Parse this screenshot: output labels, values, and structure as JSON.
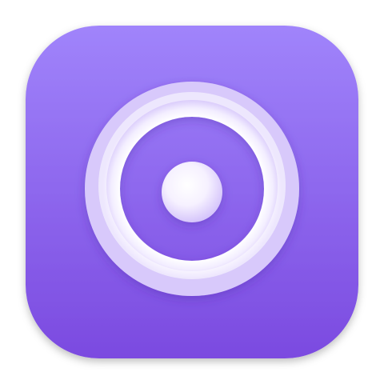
{
  "app_icon": {
    "icon": "radio-target-icon",
    "colors": {
      "tile_top": "#a084fb",
      "tile_bottom": "#7b4ae0",
      "ring": "#f4eeff",
      "ring_shadow": "#b69ef4",
      "dot": "#ffffff",
      "dot_shadow": "#c4b2f6"
    }
  }
}
